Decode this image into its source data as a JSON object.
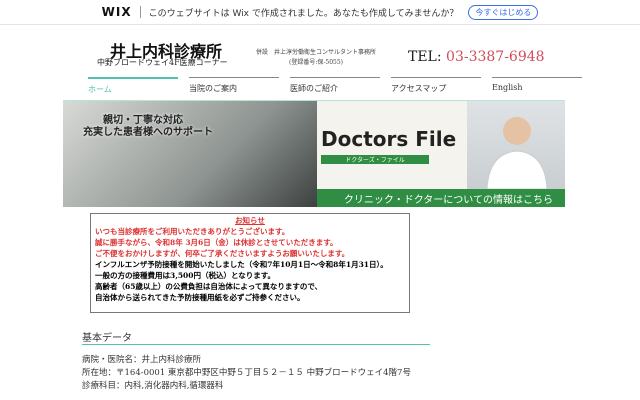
{
  "wixbar": {
    "logo": "WIX",
    "message": "このウェブサイトは Wix で作成されました。あなたも作成してみませんか？",
    "button": "今すぐはじめる"
  },
  "header": {
    "title": "井上内科診療所",
    "subtitle": "中野ブロードウェイ4F医療コーナー",
    "affiliate": "併設　井上淳労働衛生コンサルタント事務所",
    "registration": "(登録番号:保-5055)",
    "tel_label": "TEL: ",
    "tel": "03-3387-6948"
  },
  "nav": [
    {
      "label": "ホーム"
    },
    {
      "label": "当院のご案内"
    },
    {
      "label": "医師のご紹介"
    },
    {
      "label": "アクセスマップ"
    },
    {
      "label": "English"
    }
  ],
  "banner": {
    "left_line1": "親切・丁寧な対応",
    "left_line2": "充実した患者様へのサポート",
    "brand": "Doctors File",
    "brand_sub": "ドクターズ・ファイル",
    "caption": "クリニック・ドクターについての情報はこちら"
  },
  "notice": {
    "heading": "お知らせ",
    "red_lines": [
      "いつも当診療所をご利用いただきありがとうございます。",
      "誠に勝手ながら、令和8年 3月6日（金）は休診とさせていただきます。",
      "ご不便をおかけしますが、何卒ご了承くださいますようお願いいたします。"
    ],
    "lines": [
      "インフルエンザ予防接種を開始いたしました（令和7年10月1日～令和8年1月31日）。",
      "一般の方の接種費用は3,500円（税込）となります。",
      "高齢者（65歳以上）の公費負担は自治体によって異なりますので、",
      "自治体から送られてきた予防接種用紙を必ずご持参ください。"
    ]
  },
  "basic": {
    "heading": "基本データ",
    "rows": [
      "病院・医院名：井上内科診療所",
      "所在地：〒164-0001 東京都中野区中野５丁目５２－１５ 中野ブロードウェイ4階7号",
      "診療科目：内科,消化器内科,循環器科"
    ]
  }
}
